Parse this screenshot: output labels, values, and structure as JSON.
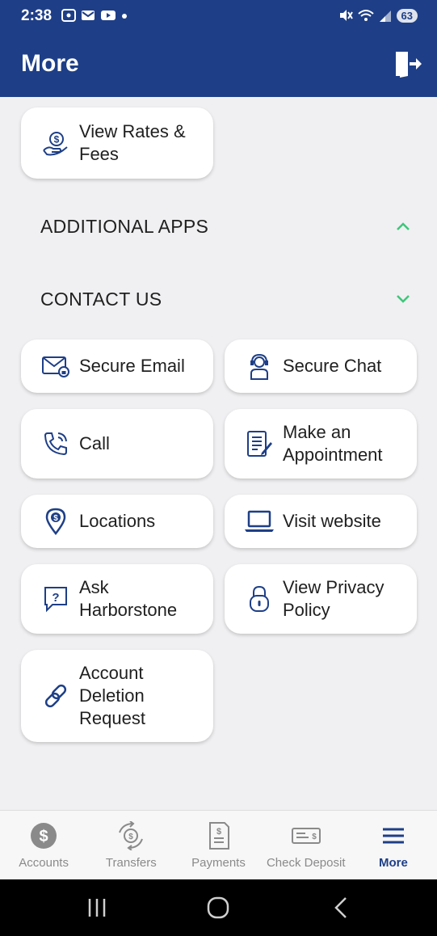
{
  "status": {
    "time": "2:38",
    "battery": "63"
  },
  "header": {
    "title": "More"
  },
  "rates_card": {
    "label": "View Rates & Fees"
  },
  "sections": {
    "additional_apps": "ADDITIONAL APPS",
    "contact_us": "CONTACT US"
  },
  "contact": {
    "secure_email": "Secure Email",
    "secure_chat": "Secure Chat",
    "call": "Call",
    "make_appointment": "Make an Appointment",
    "locations": "Locations",
    "visit_website": "Visit website",
    "ask": "Ask Harborstone",
    "privacy": "View Privacy Policy",
    "account_deletion": "Account Deletion Request"
  },
  "nav": {
    "accounts": "Accounts",
    "transfers": "Transfers",
    "payments": "Payments",
    "check_deposit": "Check Deposit",
    "more": "More"
  },
  "colors": {
    "brand": "#1e3f87",
    "chevron": "#3ec77a",
    "background": "#f0f0f2"
  }
}
